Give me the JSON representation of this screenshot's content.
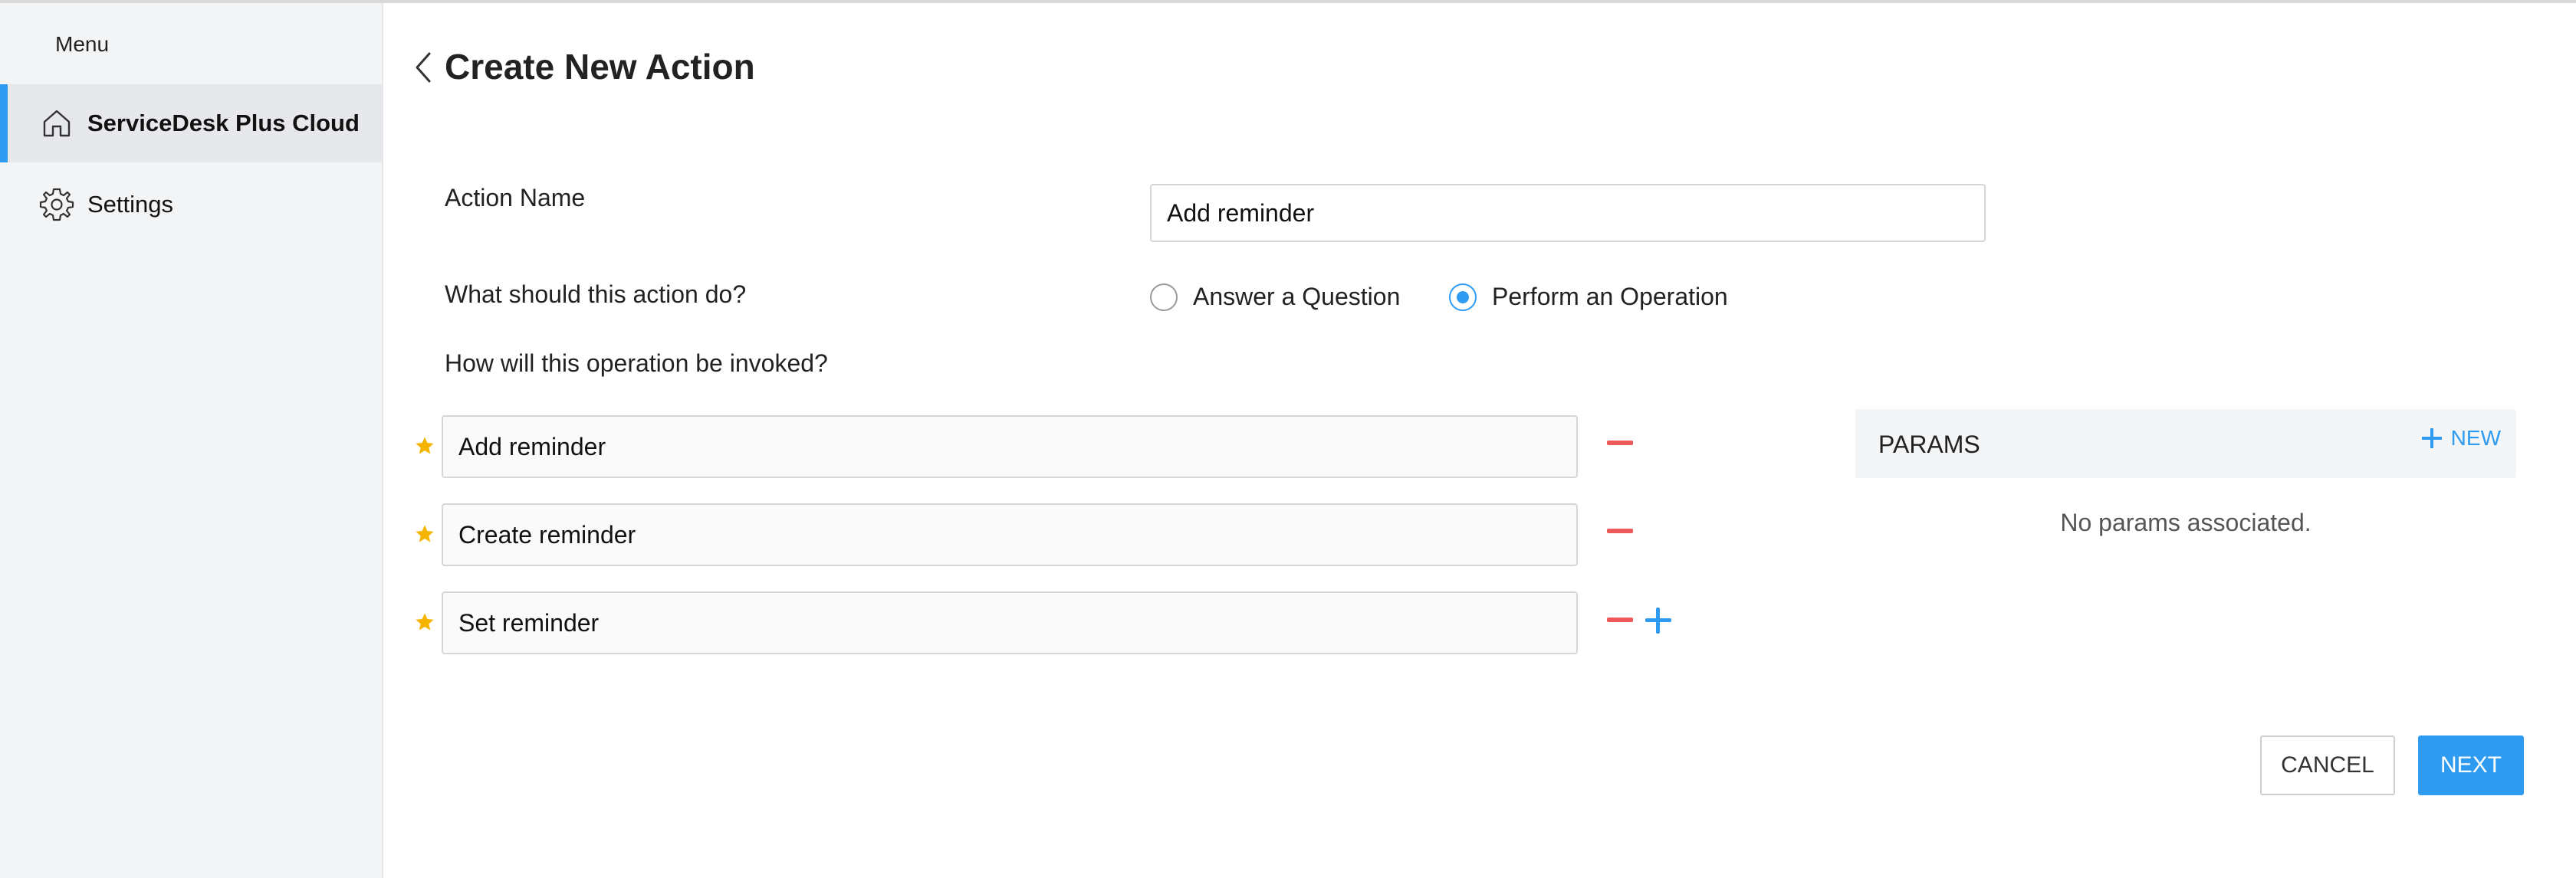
{
  "sidebar": {
    "menu_label": "Menu",
    "items": [
      {
        "label": "ServiceDesk Plus Cloud",
        "icon": "home-icon",
        "active": true
      },
      {
        "label": "Settings",
        "icon": "gear-icon",
        "active": false
      }
    ]
  },
  "header": {
    "title": "Create New Action"
  },
  "form": {
    "action_name_label": "Action Name",
    "action_name_value": "Add reminder",
    "action_type_label": "What should this action do?",
    "options": [
      {
        "label": "Answer a Question",
        "checked": false
      },
      {
        "label": "Perform an Operation",
        "checked": true
      }
    ],
    "invoke_label": "How will this operation be invoked?",
    "phrases": [
      "Add reminder",
      "Create reminder",
      "Set reminder"
    ]
  },
  "params": {
    "title": "PARAMS",
    "new_label": "NEW",
    "empty_text": "No params associated."
  },
  "buttons": {
    "cancel": "CANCEL",
    "next": "NEXT"
  },
  "colors": {
    "accent": "#2f9bf0",
    "remove": "#ee5a5a",
    "star": "#f4b400"
  }
}
